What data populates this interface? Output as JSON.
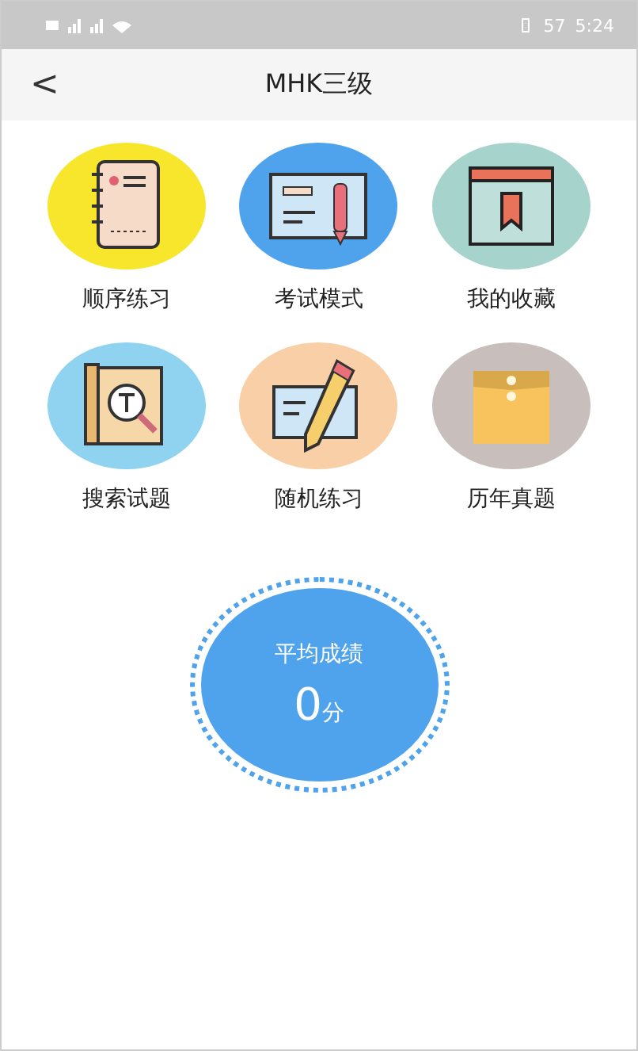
{
  "status_bar": {
    "battery": "57",
    "time": "5:24"
  },
  "header": {
    "back": "<",
    "title": "MHK三级"
  },
  "menu": [
    {
      "label": "顺序练习",
      "kind": "notebook",
      "color": "#f7e62c"
    },
    {
      "label": "考试模式",
      "kind": "card",
      "color": "#4fa3ec"
    },
    {
      "label": "我的收藏",
      "kind": "bookmark",
      "color": "#a6d3cb"
    },
    {
      "label": "搜索试题",
      "kind": "search",
      "color": "#8fd3f0"
    },
    {
      "label": "随机练习",
      "kind": "pencil",
      "color": "#f8cfa6"
    },
    {
      "label": "历年真题",
      "kind": "envelope",
      "color": "#c8bfbd"
    }
  ],
  "score": {
    "label": "平均成绩",
    "value": "0",
    "unit": "分"
  }
}
